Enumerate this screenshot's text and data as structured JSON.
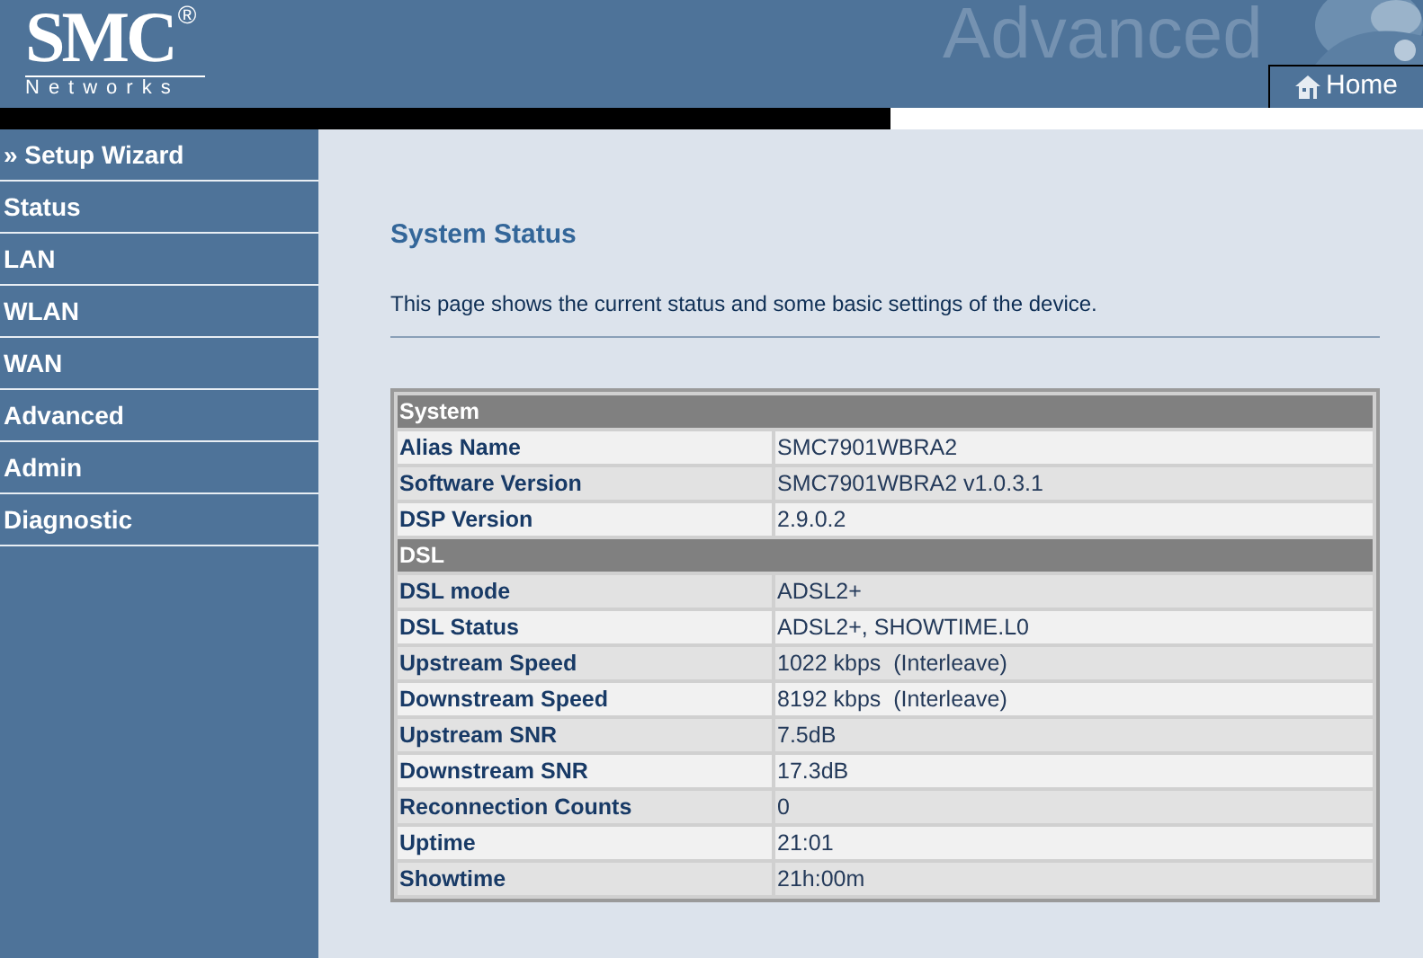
{
  "header": {
    "logo": "SMC",
    "logo_mark": "®",
    "logo_sub": "Networks",
    "banner_text": "Advanced",
    "home_tab": "Home"
  },
  "sidebar": {
    "items": [
      {
        "label": "» Setup Wizard"
      },
      {
        "label": "Status"
      },
      {
        "label": "LAN"
      },
      {
        "label": "WLAN"
      },
      {
        "label": "WAN"
      },
      {
        "label": "Advanced"
      },
      {
        "label": "Admin"
      },
      {
        "label": "Diagnostic"
      }
    ]
  },
  "page": {
    "title": "System Status",
    "description": "This page shows the current status and some basic settings of the device."
  },
  "table": {
    "rows": [
      {
        "kind": "section",
        "label": "System"
      },
      {
        "kind": "row",
        "label": "Alias Name",
        "value": "SMC7901WBRA2"
      },
      {
        "kind": "row",
        "label": "Software Version",
        "value": "SMC7901WBRA2 v1.0.3.1"
      },
      {
        "kind": "row",
        "label": "DSP Version",
        "value": "2.9.0.2"
      },
      {
        "kind": "section",
        "label": "DSL"
      },
      {
        "kind": "row",
        "label": "DSL mode",
        "value": "ADSL2+"
      },
      {
        "kind": "row",
        "label": "DSL Status",
        "value": "ADSL2+, SHOWTIME.L0"
      },
      {
        "kind": "row",
        "label": "Upstream Speed",
        "value": "1022 kbps  (Interleave)"
      },
      {
        "kind": "row",
        "label": "Downstream Speed",
        "value": "8192 kbps  (Interleave)"
      },
      {
        "kind": "row",
        "label": "Upstream SNR",
        "value": "7.5dB"
      },
      {
        "kind": "row",
        "label": "Downstream SNR",
        "value": "17.3dB"
      },
      {
        "kind": "row",
        "label": "Reconnection Counts",
        "value": "0"
      },
      {
        "kind": "row",
        "label": "Uptime",
        "value": "21:01"
      },
      {
        "kind": "row",
        "label": "Showtime",
        "value": "21h:00m"
      }
    ]
  }
}
